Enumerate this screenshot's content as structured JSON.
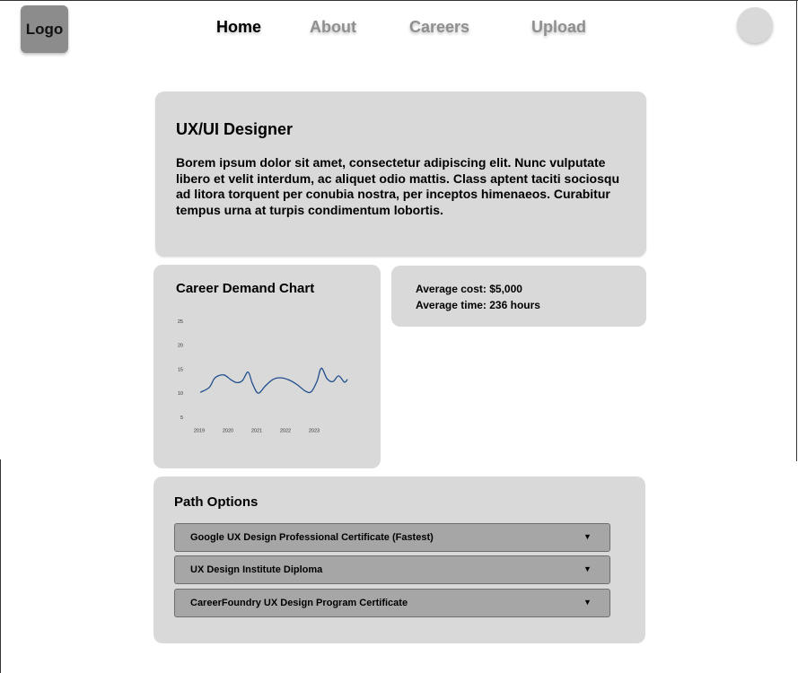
{
  "header": {
    "logo": "Logo",
    "nav": [
      {
        "label": "Home",
        "active": true
      },
      {
        "label": "About",
        "active": false
      },
      {
        "label": "Careers",
        "active": false
      },
      {
        "label": "Upload",
        "active": false
      }
    ]
  },
  "intro": {
    "title": "UX/UI Designer",
    "body_lines": [
      "Borem ipsum dolor sit amet, consectetur adipiscing elit. Nunc vulputate",
      "libero et velit interdum, ac aliquet odio mattis. Class aptent taciti sociosqu",
      "ad litora torquent per conubia nostra, per inceptos himenaeos. Curabitur",
      "tempus urna at turpis condimentum lobortis."
    ]
  },
  "chart_data": {
    "type": "line",
    "title": "Career Demand Chart",
    "xlabel": "",
    "ylabel": "",
    "x_ticks": [
      "2019",
      "2020",
      "2021",
      "2022",
      "2023"
    ],
    "y_ticks": [
      5,
      10,
      15,
      20,
      25
    ],
    "xlim": [
      2019,
      2024.2
    ],
    "ylim": [
      0,
      25
    ],
    "grid": false,
    "color": "#1f4e8c",
    "series": [
      {
        "x": [
          2019.05,
          2019.35,
          2019.55,
          2019.85,
          2020.1,
          2020.3,
          2020.5,
          2020.7,
          2020.85,
          2021.05,
          2021.3,
          2021.55,
          2021.8,
          2022.1,
          2022.4,
          2022.7,
          2022.9,
          2023.1,
          2023.25,
          2023.45,
          2023.65,
          2023.85,
          2024.05,
          2024.15
        ],
        "values": [
          10.2,
          11.2,
          13.2,
          13.8,
          12.8,
          12.2,
          12.6,
          14.4,
          12.0,
          10.0,
          11.5,
          12.8,
          13.2,
          12.8,
          11.8,
          10.4,
          10.3,
          12.5,
          15.2,
          13.0,
          12.4,
          13.6,
          12.3,
          12.8
        ]
      }
    ]
  },
  "stats": {
    "average_cost": "Average cost: $5,000",
    "average_time": "Average time: 236 hours"
  },
  "paths": {
    "title": "Path Options",
    "caret": "▼",
    "options": [
      "Google UX Design Professional Certificate (Fastest)",
      "UX Design Institute Diploma",
      "CareerFoundry UX Design Program Certificate"
    ]
  }
}
